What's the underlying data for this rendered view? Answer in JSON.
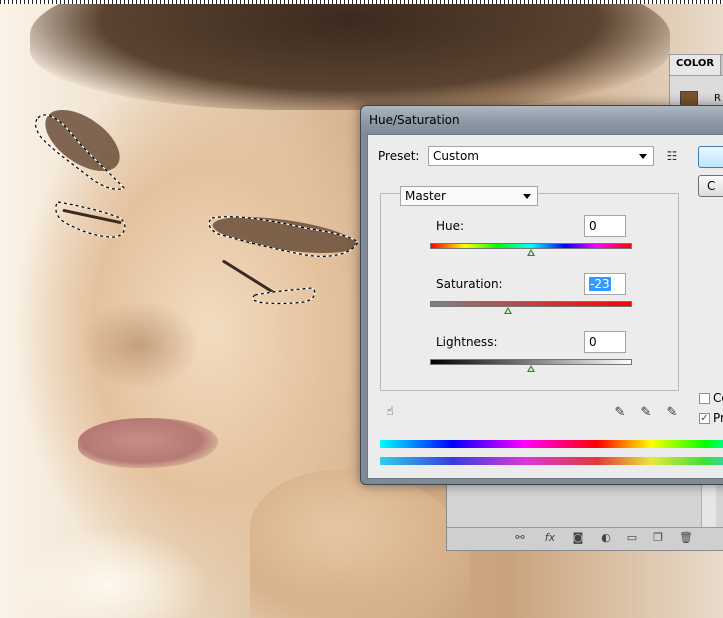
{
  "dialog": {
    "title": "Hue/Saturation",
    "preset_label": "Preset:",
    "preset_value": "Custom",
    "channel_value": "Master",
    "hue": {
      "label": "Hue:",
      "value": "0",
      "position": 0.5
    },
    "saturation": {
      "label": "Saturation:",
      "value": "-23",
      "position": 0.385
    },
    "lightness": {
      "label": "Lightness:",
      "value": "0",
      "position": 0.5
    },
    "buttons": {
      "ok_label": "",
      "cancel_label": "C"
    },
    "options": {
      "colorize_label": "Co",
      "colorize_checked": false,
      "preview_label": "Pr",
      "preview_checked": true
    }
  },
  "color_panel": {
    "tab_label": "COLOR",
    "channel_label": "R",
    "swatch_color": "#7a5330"
  },
  "icons": {
    "preset_menu": "list-menu-icon",
    "on_image_adjust": "hand-target-icon",
    "eyedropper": "eyedropper-icon",
    "eyedropper_add": "eyedropper-plus-icon",
    "eyedropper_subtract": "eyedropper-minus-icon",
    "layers_footer": [
      "link-icon",
      "fx-icon",
      "mask-icon",
      "adjustment-icon",
      "folder-icon",
      "new-layer-icon",
      "trash-icon"
    ]
  }
}
